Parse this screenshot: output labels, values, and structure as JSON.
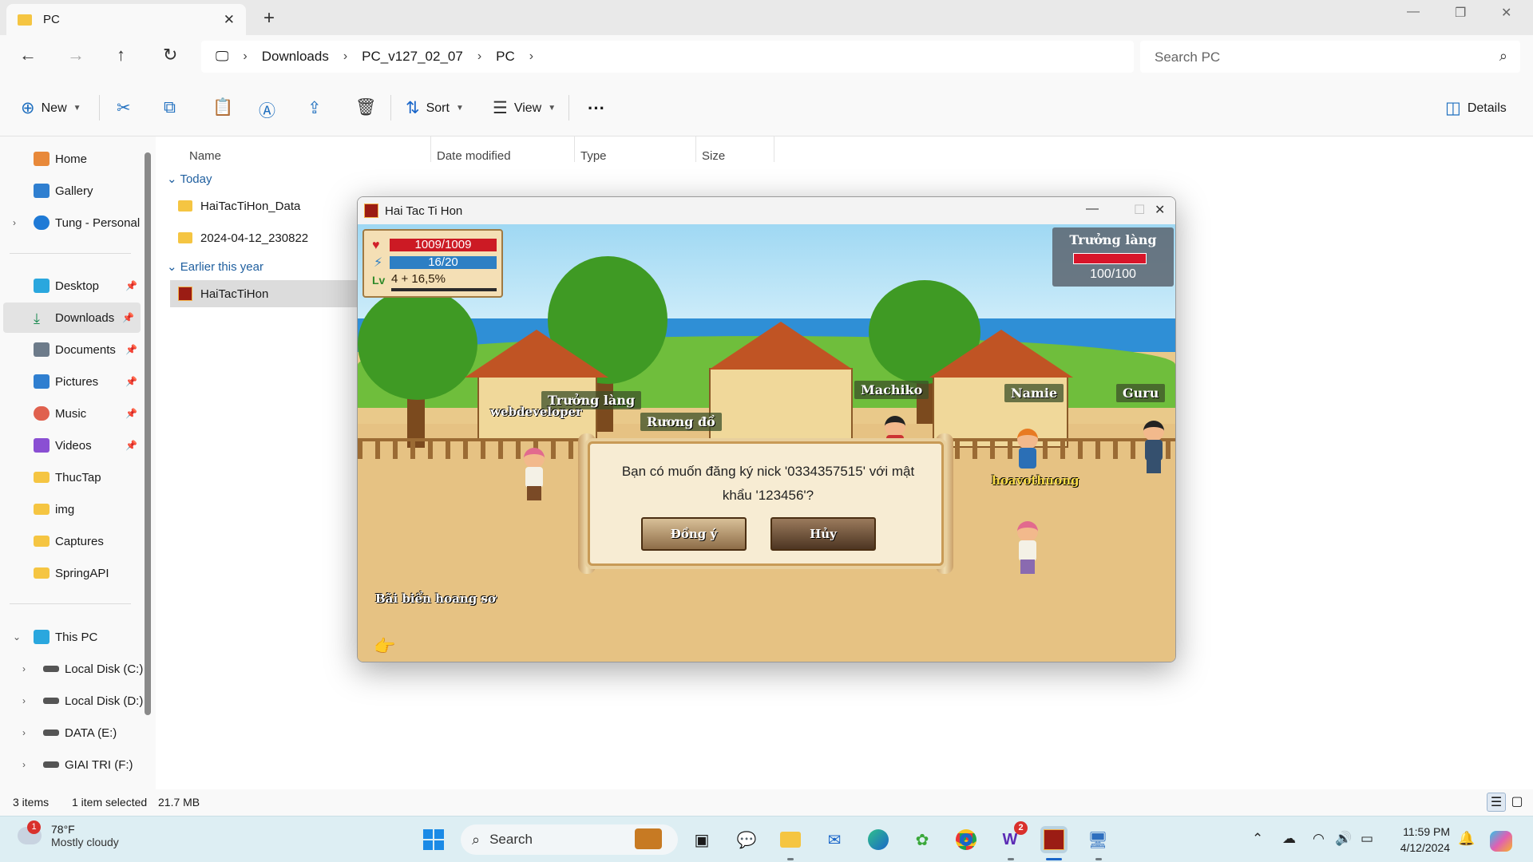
{
  "explorer": {
    "tab_title": "PC",
    "breadcrumbs": [
      "Downloads",
      "PC_v127_02_07",
      "PC"
    ],
    "search_placeholder": "Search PC",
    "commands": {
      "new": "New",
      "sort": "Sort",
      "view": "View",
      "details": "Details"
    },
    "nav": {
      "home": "Home",
      "gallery": "Gallery",
      "onedrive": "Tung - Personal",
      "desktop": "Desktop",
      "downloads": "Downloads",
      "documents": "Documents",
      "pictures": "Pictures",
      "music": "Music",
      "videos": "Videos",
      "thuctap": "ThucTap",
      "img": "img",
      "captures": "Captures",
      "springapi": "SpringAPI",
      "thispc": "This PC",
      "drive_c": "Local Disk (C:)",
      "drive_d": "Local Disk (D:)",
      "drive_e": "DATA (E:)",
      "drive_f": "GIAI TRI (F:)"
    },
    "columns": [
      "Name",
      "Date modified",
      "Type",
      "Size"
    ],
    "groups": {
      "today": "Today",
      "earlier": "Earlier this year"
    },
    "files": {
      "f1": "HaiTacTiHon_Data",
      "f2": "2024-04-12_230822",
      "f3": "HaiTacTiHon"
    },
    "status": {
      "items": "3 items",
      "selected": "1 item selected",
      "size": "21.7 MB"
    }
  },
  "game": {
    "window_title": "Hai Tac Ti Hon",
    "hp": "1009/1009",
    "mp": "16/20",
    "level": "4 + 16,5%",
    "boss_name": "Trưởng làng",
    "boss_hp": "100/100",
    "labels": {
      "truong_lang": "Trưởng làng",
      "webdeveloper": "webdeveloper",
      "ruong_do": "Rương đồ",
      "machiko": "Machiko",
      "namie": "Namie",
      "guru": "Guru",
      "hoavothuong": "hoavothuong",
      "map_name": "Bãi biển hoang sơ"
    },
    "dialog": {
      "message": "Bạn có muốn đăng ký nick '0334357515' với mật khẩu '123456'?",
      "ok": "Đồng ý",
      "cancel": "Hủy"
    }
  },
  "taskbar": {
    "weather_temp": "78°F",
    "weather_desc": "Mostly cloudy",
    "weather_badge": "1",
    "search": "Search",
    "app_badge": "2",
    "time": "11:59 PM",
    "date": "4/12/2024"
  },
  "colors": {
    "accent": "#1a66c9",
    "folder": "#f5c542",
    "hp": "#cc1a24",
    "mp": "#2d7fc4"
  }
}
